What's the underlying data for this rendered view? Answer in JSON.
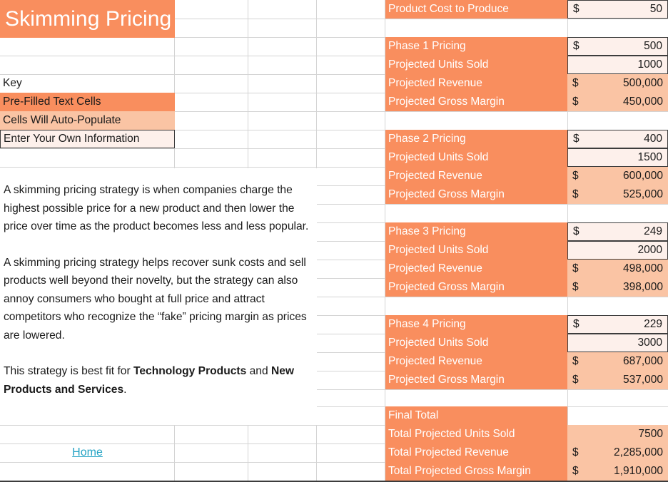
{
  "document": {
    "title": "Skimming Pricing"
  },
  "key": {
    "heading": "Key",
    "items": [
      {
        "label": "Pre-Filled Text Cells",
        "style": "orange"
      },
      {
        "label": "Cells Will Auto-Populate",
        "style": "salmon"
      },
      {
        "label": "Enter Your Own Information",
        "style": "cream-boxed"
      }
    ]
  },
  "description": {
    "paragraph1": "A skimming pricing strategy is when companies charge the highest possible price for a new product and then lower the price over time as the product becomes less and less popular.",
    "paragraph2": "A skimming pricing strategy helps recover sunk costs and sell products well beyond their novelty, but the strategy can also annoy consumers who bought at full price and attract competitors who recognize the “fake” pricing margin as prices are lowered.",
    "paragraph3_prefix": "This strategy is best fit for ",
    "paragraph3_bold1": "Technology Products",
    "paragraph3_middle": " and ",
    "paragraph3_bold2": "New Products and Services",
    "paragraph3_suffix": "."
  },
  "navigation": {
    "home_link": "Home"
  },
  "model": {
    "cost": {
      "label": "Product Cost to Produce",
      "symbol": "$",
      "value": "50"
    },
    "phases": [
      {
        "price_label": "Phase 1 Pricing",
        "price_symbol": "$",
        "price_value": "500",
        "units_label": "Projected Units Sold",
        "units_value": "1000",
        "revenue_label": "Projected Revenue",
        "revenue_symbol": "$",
        "revenue_value": "500,000",
        "margin_label": "Projected Gross Margin",
        "margin_symbol": "$",
        "margin_value": "450,000"
      },
      {
        "price_label": "Phase 2 Pricing",
        "price_symbol": "$",
        "price_value": "400",
        "units_label": "Projected Units Sold",
        "units_value": "1500",
        "revenue_label": "Projected Revenue",
        "revenue_symbol": "$",
        "revenue_value": "600,000",
        "margin_label": "Projected Gross Margin",
        "margin_symbol": "$",
        "margin_value": "525,000"
      },
      {
        "price_label": "Phase 3 Pricing",
        "price_symbol": "$",
        "price_value": "249",
        "units_label": "Projected Units Sold",
        "units_value": "2000",
        "revenue_label": "Projected Revenue",
        "revenue_symbol": "$",
        "revenue_value": "498,000",
        "margin_label": "Projected Gross Margin",
        "margin_symbol": "$",
        "margin_value": "398,000"
      },
      {
        "price_label": "Phase 4 Pricing",
        "price_symbol": "$",
        "price_value": "229",
        "units_label": "Projected Units Sold",
        "units_value": "3000",
        "revenue_label": "Projected Revenue",
        "revenue_symbol": "$",
        "revenue_value": "687,000",
        "margin_label": "Projected Gross Margin",
        "margin_symbol": "$",
        "margin_value": "537,000"
      }
    ],
    "final": {
      "heading": "Final Total",
      "units_label": "Total Projected Units Sold",
      "units_value": "7500",
      "revenue_label": "Total Projected Revenue",
      "revenue_symbol": "$",
      "revenue_value": "2,285,000",
      "margin_label": "Total Projected Gross Margin",
      "margin_symbol": "$",
      "margin_value": "1,910,000"
    }
  },
  "colors": {
    "accent_orange": "#F98E5E",
    "auto_populate_salmon": "#FAC4A4",
    "input_cream": "#FDF0EB",
    "link_blue": "#24A3C4",
    "gridline": "#d4d4d4"
  }
}
